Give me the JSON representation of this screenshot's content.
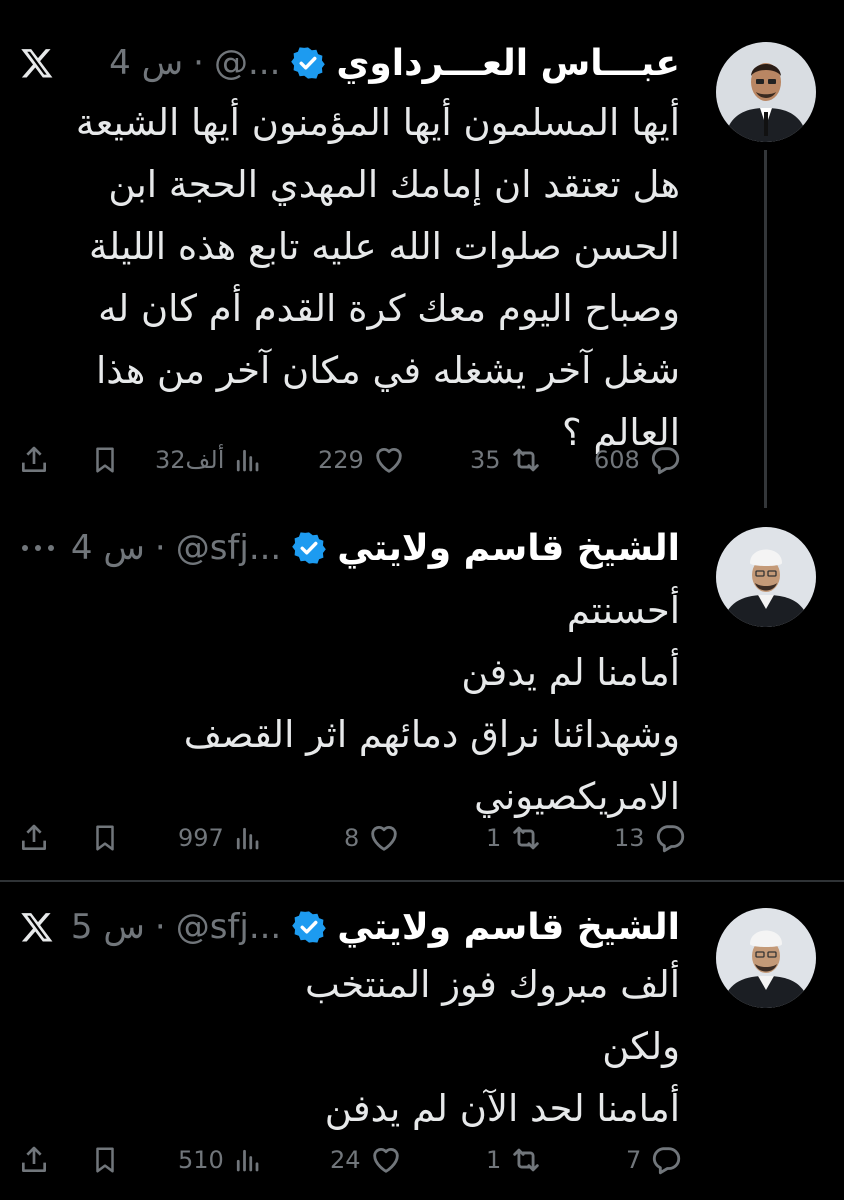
{
  "tweets": [
    {
      "name": "عبـــاس العـــرداوي",
      "handle": "@...",
      "time": "4 س",
      "corner_icon": "x-logo-icon",
      "lines": [
        "أيها المسلمون أيها المؤمنون أيها الشيعة",
        "هل تعتقد ان إمامك المهدي الحجة ابن",
        "الحسن صلوات الله عليه تابع هذه الليلة",
        "وصباح اليوم معك كرة القدم أم كان له",
        "شغل آخر يشغله في مكان آخر من هذا",
        "العالم ؟"
      ],
      "stats": {
        "replies": "608",
        "reposts": "35",
        "likes": "229",
        "views": "32ألف"
      }
    },
    {
      "name": "الشيخ قاسم ولايتي",
      "handle": "@sfj...",
      "time": "4 س",
      "corner_icon": "more-dots-icon",
      "lines": [
        "أحسنتم",
        "أمامنا لم يدفن",
        "وشهدائنا نراق دمائهم اثر القصف",
        "الامريكصيوني"
      ],
      "stats": {
        "replies": "13",
        "reposts": "1",
        "likes": "8",
        "views": "997"
      }
    },
    {
      "name": "الشيخ قاسم ولايتي",
      "handle": "@sfj...",
      "time": "5 س",
      "corner_icon": "x-logo-icon",
      "lines": [
        "ألف مبروك فوز المنتخب",
        "ولكن",
        "أمامنا لحد الآن لم يدفن"
      ],
      "stats": {
        "replies": "7",
        "reposts": "1",
        "likes": "24",
        "views": "510"
      }
    }
  ],
  "separator": "·",
  "colors": {
    "background": "#000000",
    "text": "#e7e9ea",
    "muted": "#71767b",
    "verified": "#1d9bf0"
  }
}
